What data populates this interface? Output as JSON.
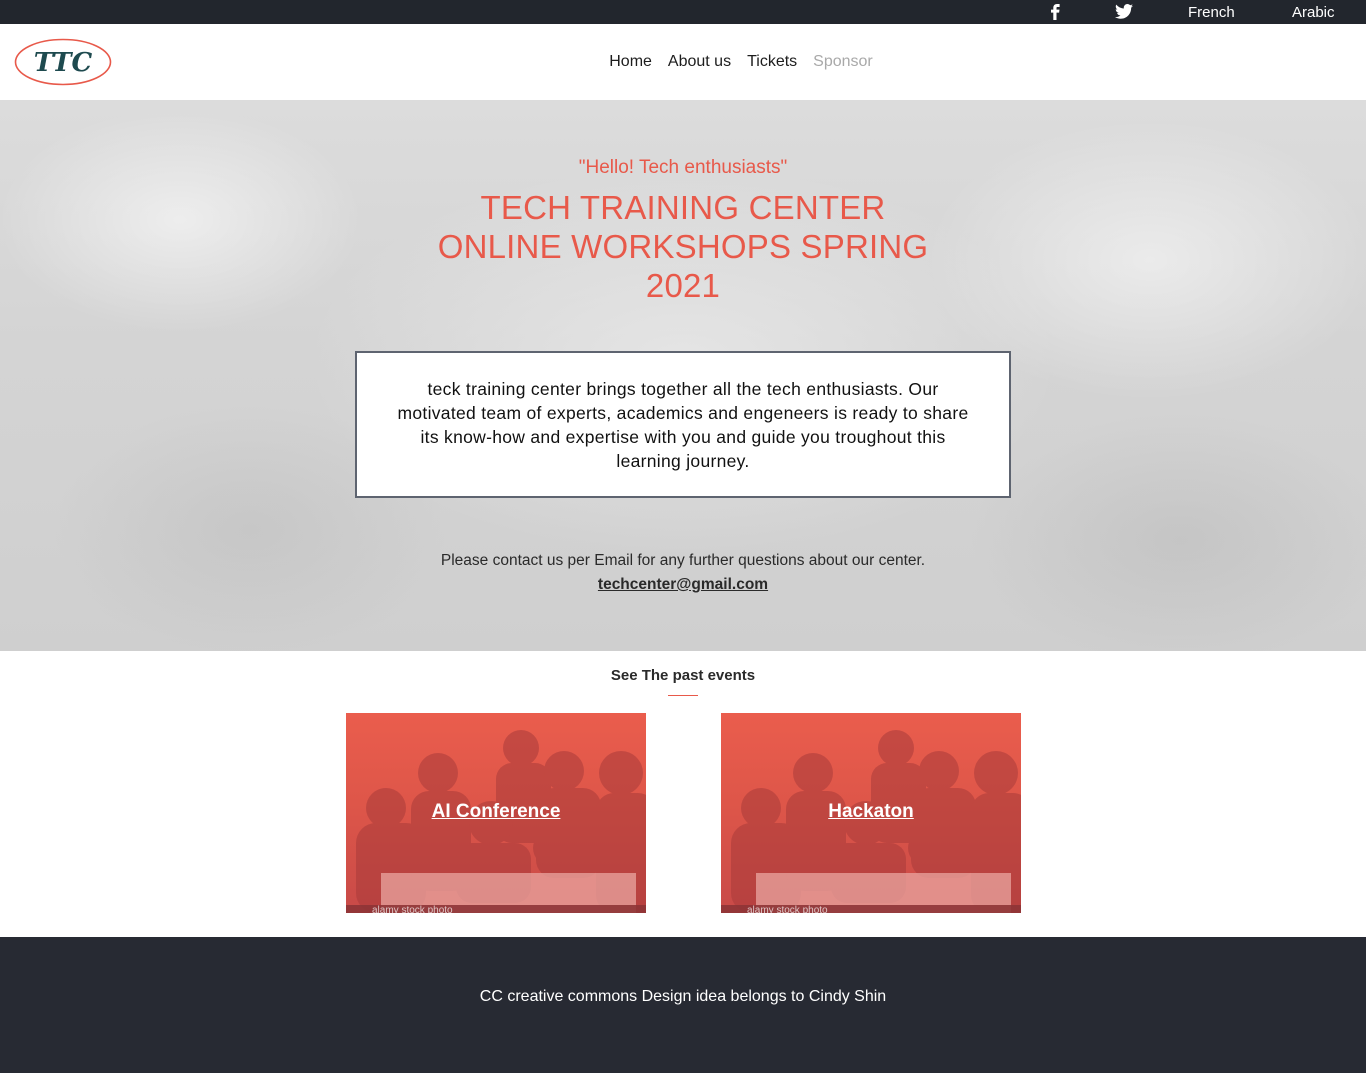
{
  "topbar": {
    "social": [
      {
        "icon": "facebook-icon",
        "label": ""
      },
      {
        "icon": "twitter-icon",
        "label": ""
      }
    ],
    "languages": [
      "French",
      "Arabic"
    ]
  },
  "header": {
    "logo_text": "TTC",
    "nav": [
      "Home",
      "About us",
      "Tickets",
      "Sponsor"
    ]
  },
  "hero": {
    "greeting": "\"Hello! Tech enthusiasts\"",
    "title_line1": "TECH TRAINING CENTER",
    "title_line2": "ONLINE WORKSHOPS SPRING",
    "title_line3": "2021",
    "intro": "teck training center brings together all the tech enthusiasts. Our motivated team of experts, academics and engeneers is ready to share its know-how and expertise with you and guide you troughout this learning journey.",
    "contact_text": "Please contact us per Email for any further questions about our center.",
    "email": "techcenter@gmail.com"
  },
  "events": {
    "title": "See The past events",
    "cards": [
      {
        "label": "AI Conference",
        "watermark": "alamy stock photo"
      },
      {
        "label": "Hackaton",
        "watermark": "alamy stock photo"
      }
    ]
  },
  "footer": {
    "text": "CC creative commons Design idea belongs to Cindy Shin"
  },
  "colors": {
    "accent": "#e8594a",
    "topbar": "#22262d",
    "footer": "#272a33"
  }
}
